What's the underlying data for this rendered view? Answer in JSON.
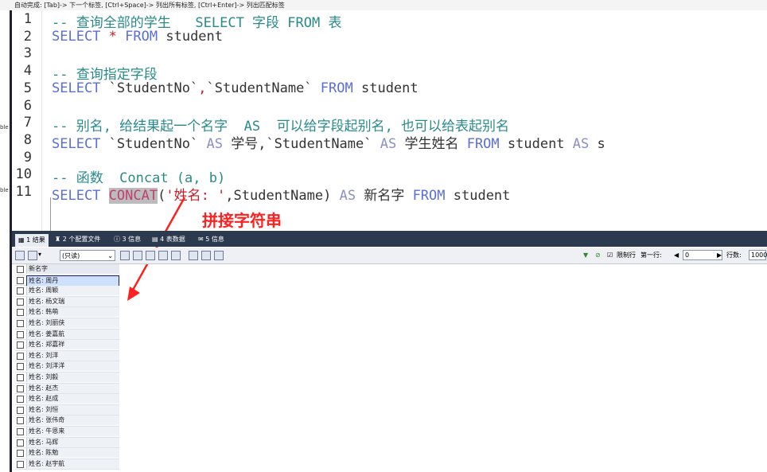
{
  "hint_bar": "自动完成: [Tab]-> 下一个标签, [Ctrl+Space]-> 列出所有标签, [Ctrl+Enter]-> 列出匹配标签",
  "side_labels": [
    "ble",
    "ble"
  ],
  "editor": {
    "line_numbers": [
      "1",
      "2",
      "3",
      "4",
      "5",
      "6",
      "7",
      "8",
      "9",
      "10",
      "11"
    ],
    "lines": [
      [
        {
          "t": "-- 查询全部的学生   SELECT 字段 FROM 表",
          "c": "cm"
        }
      ],
      [
        {
          "t": "SELECT",
          "c": "kw"
        },
        {
          "t": " ",
          "c": ""
        },
        {
          "t": "*",
          "c": "op"
        },
        {
          "t": " ",
          "c": ""
        },
        {
          "t": "FROM",
          "c": "kw"
        },
        {
          "t": " student",
          "c": ""
        }
      ],
      [],
      [
        {
          "t": "-- 查询指定字段",
          "c": "cm"
        }
      ],
      [
        {
          "t": "SELECT",
          "c": "kw"
        },
        {
          "t": " `StudentNo`",
          "c": ""
        },
        {
          "t": ",",
          "c": "op"
        },
        {
          "t": "`StudentName` ",
          "c": ""
        },
        {
          "t": "FROM",
          "c": "kw"
        },
        {
          "t": " student",
          "c": ""
        }
      ],
      [],
      [
        {
          "t": "-- 别名, 给结果起一个名字  AS  可以给字段起别名, 也可以给表起别名",
          "c": "cm"
        }
      ],
      [
        {
          "t": "SELECT",
          "c": "kw"
        },
        {
          "t": " `StudentNo` ",
          "c": ""
        },
        {
          "t": "AS",
          "c": "kw2"
        },
        {
          "t": " 学号,`StudentName` ",
          "c": ""
        },
        {
          "t": "AS",
          "c": "kw2"
        },
        {
          "t": " 学生姓名 ",
          "c": ""
        },
        {
          "t": "FROM",
          "c": "kw"
        },
        {
          "t": " student ",
          "c": ""
        },
        {
          "t": "AS",
          "c": "kw2"
        },
        {
          "t": " s",
          "c": ""
        }
      ],
      [],
      [
        {
          "t": "-- 函数  Concat (a, b)",
          "c": "cm"
        }
      ],
      [
        {
          "t": "SELECT",
          "c": "kw"
        },
        {
          "t": " ",
          "c": ""
        },
        {
          "t": "CONCAT",
          "c": "hl"
        },
        {
          "t": "(",
          "c": ""
        },
        {
          "t": "'姓名: '",
          "c": "str"
        },
        {
          "t": ",StudentName) ",
          "c": ""
        },
        {
          "t": "AS",
          "c": "kw2"
        },
        {
          "t": " 新名字 ",
          "c": ""
        },
        {
          "t": "FROM",
          "c": "kw"
        },
        {
          "t": " student",
          "c": ""
        }
      ]
    ]
  },
  "annotation": "拼接字符串",
  "tabs": [
    {
      "label": "1 结果",
      "active": true
    },
    {
      "label": "2 个配置文件",
      "active": false
    },
    {
      "label": "3 信息",
      "active": false
    },
    {
      "label": "4 表数据",
      "active": false
    },
    {
      "label": "5 信息",
      "active": false
    }
  ],
  "toolbar": {
    "mode_select": "(只读)",
    "limit_rows_label": "限制行",
    "first_row_label": "第一行:",
    "first_row_value": "0",
    "rows_label": "行数:",
    "rows_value": "1000",
    "limit_checked": true
  },
  "results": {
    "column": "新名字",
    "rows": [
      "姓名: 周丹",
      "姓名: 周颖",
      "姓名: 杨文瑞",
      "姓名: 韩萌",
      "姓名: 刘丽侠",
      "姓名: 姜嘉航",
      "姓名: 郑嘉祥",
      "姓名: 刘洋",
      "姓名: 刘洋洋",
      "姓名: 刘毅",
      "姓名: 赵杰",
      "姓名: 赵成",
      "姓名: 刘恒",
      "姓名: 张伟奇",
      "姓名: 牛恩来",
      "姓名: 马辉",
      "姓名: 陈勉",
      "姓名: 赵宇航"
    ],
    "selected_index": 0
  }
}
